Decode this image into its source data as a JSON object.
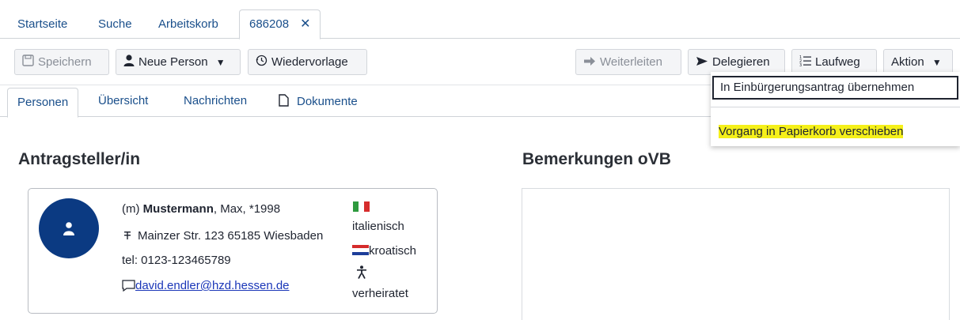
{
  "top_tabs": {
    "startseite": "Startseite",
    "suche": "Suche",
    "arbeitskorb": "Arbeitskorb",
    "active": "686208",
    "close_symbol": "✕"
  },
  "toolbar": {
    "save": "Speichern",
    "new_person": "Neue Person",
    "resubmission": "Wiedervorlage",
    "forward": "Weiterleiten",
    "delegate": "Delegieren",
    "workflow": "Laufweg",
    "action": "Aktion"
  },
  "inner_tabs": {
    "personen": "Personen",
    "uebersicht": "Übersicht",
    "nachrichten": "Nachrichten",
    "dokumente": "Dokumente"
  },
  "action_menu": {
    "item1": "In Einbürgerungsantrag übernehmen",
    "item2": "Vorgang in Papierkorb verschieben",
    "highlight_color": "#f5f01a"
  },
  "sections": {
    "applicant": "Antragsteller/in",
    "remarks": "Bemerkungen oVB"
  },
  "person": {
    "gender": "(m)",
    "surname": "Mustermann",
    "rest": ", Max, *1998",
    "address": "Mainzer Str. 123 65185 Wiesbaden",
    "phone": "tel: 0123-123465789",
    "email": "david.endler@hzd.hessen.de",
    "nationality1": "italienisch",
    "nationality2": "kroatisch",
    "marital_status": "verheiratet"
  },
  "colors": {
    "link": "#1a4f8b",
    "avatar": "#0b3a82"
  }
}
